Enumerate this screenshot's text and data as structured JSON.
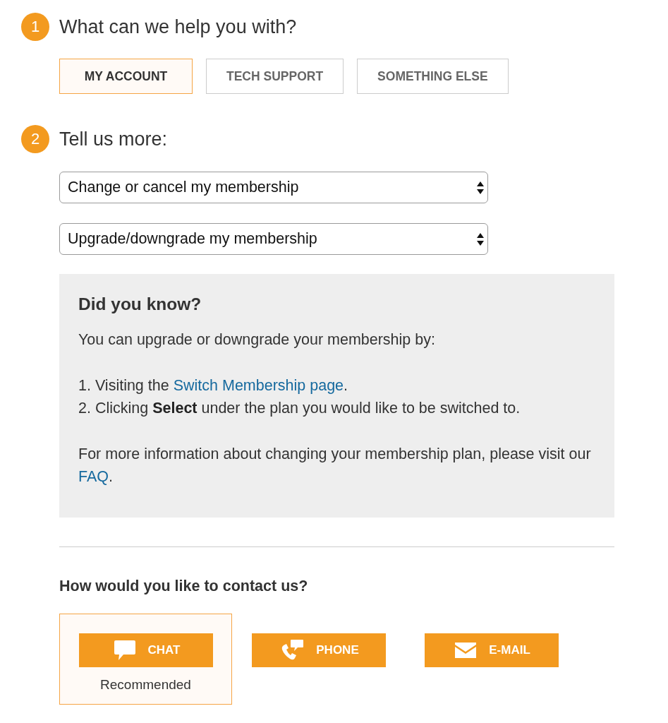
{
  "step_1": {
    "number": "1",
    "title": "What can we help you with?",
    "options": [
      {
        "label": "MY ACCOUNT",
        "selected": true
      },
      {
        "label": "TECH SUPPORT",
        "selected": false
      },
      {
        "label": "SOMETHING ELSE",
        "selected": false
      }
    ]
  },
  "step_2": {
    "number": "2",
    "title": "Tell us more:",
    "selects": [
      {
        "value": "Change or cancel my membership"
      },
      {
        "value": "Upgrade/downgrade my membership"
      }
    ]
  },
  "info_box": {
    "title": "Did you know?",
    "intro": "You can upgrade or downgrade your membership by:",
    "items": [
      {
        "text": "1. Visiting the ",
        "link": "Switch Membership page",
        "after": "."
      },
      {
        "text": "2. Clicking **Select** under the plan you would like to be switched to."
      }
    ],
    "footer": {
      "text": "For more information about changing your membership plan, please visit our ",
      "link": "FAQ",
      "after": "."
    }
  },
  "contact": {
    "title": "How would you like to contact us?",
    "options": [
      {
        "kind": "chat",
        "label": "CHAT",
        "selected": true,
        "note": "Recommended"
      },
      {
        "kind": "phone",
        "label": "PHONE",
        "selected": false
      },
      {
        "kind": "email",
        "label": "E-MAIL",
        "selected": false
      }
    ]
  }
}
